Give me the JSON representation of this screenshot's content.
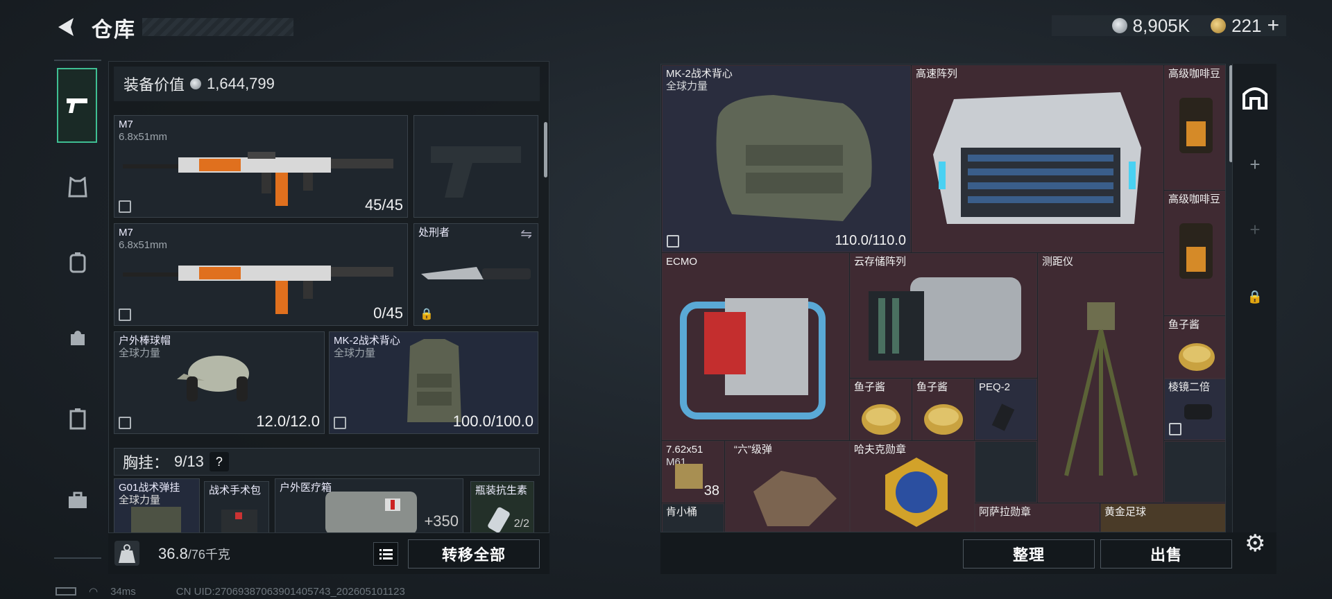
{
  "header": {
    "title": "仓库",
    "currency_silver": "8,905K",
    "currency_gold": "221",
    "currency_plus": "+"
  },
  "sidebar": {
    "items": [
      "weapon-icon",
      "armor-icon",
      "backpack-icon",
      "bag-icon",
      "case-icon",
      "toolbox-icon"
    ]
  },
  "equipment": {
    "value_label": "装备价值",
    "value": "1,644,799",
    "slots": [
      {
        "name": "M7",
        "sub": "6.8x51mm",
        "count": "45/45"
      },
      {
        "name": "M7",
        "sub": "6.8x51mm",
        "count": "0/45"
      },
      {
        "name": "处刑者",
        "sub": "",
        "count": ""
      },
      {
        "name": "户外棒球帽",
        "sub": "全球力量",
        "count": "12.0/12.0"
      },
      {
        "name": "MK-2战术背心",
        "sub": "全球力量",
        "count": "100.0/100.0"
      }
    ],
    "chest_label": "胸挂：",
    "chest_count": "9/13",
    "chest_help": "?",
    "rig_items": [
      {
        "name": "G01战术弹挂",
        "sub": "全球力量"
      },
      {
        "name": "战术手术包",
        "sub": ""
      },
      {
        "name": "户外医疗箱",
        "sub": "",
        "count": "+350"
      },
      {
        "name": "瓶装抗生素",
        "sub": "",
        "count": "2/2"
      }
    ]
  },
  "weight": {
    "value": "36.8",
    "max": "/76千克"
  },
  "buttons": {
    "transfer_all": "转移全部",
    "organize": "整理",
    "sell": "出售"
  },
  "stash": {
    "items": [
      {
        "name": "MK-2战术背心",
        "sub": "全球力量",
        "count": "110.0/110.0"
      },
      {
        "name": "高速阵列"
      },
      {
        "name": "高级咖啡豆"
      },
      {
        "name": "高级咖啡豆"
      },
      {
        "name": "ECMO"
      },
      {
        "name": "云存储阵列"
      },
      {
        "name": "测距仪"
      },
      {
        "name": "鱼子酱"
      },
      {
        "name": "鱼子酱"
      },
      {
        "name": "鱼子酱"
      },
      {
        "name": "PEQ-2"
      },
      {
        "name": "棱镜二倍"
      },
      {
        "name": "7.62x51",
        "sub": "M61",
        "count": "38"
      },
      {
        "name": "“六”级弹"
      },
      {
        "name": "哈夫克勋章"
      },
      {
        "name": "肯小桶"
      },
      {
        "name": "阿萨拉勋章"
      },
      {
        "name": "黄金足球"
      }
    ]
  },
  "status": {
    "ping": "34ms",
    "uid": "CN UID:27069387063901405743_202605101123"
  },
  "colors": {
    "active_tab": "#3fbf93",
    "red_cell": "#3f2a32",
    "blue_cell": "#2a2d3e"
  }
}
